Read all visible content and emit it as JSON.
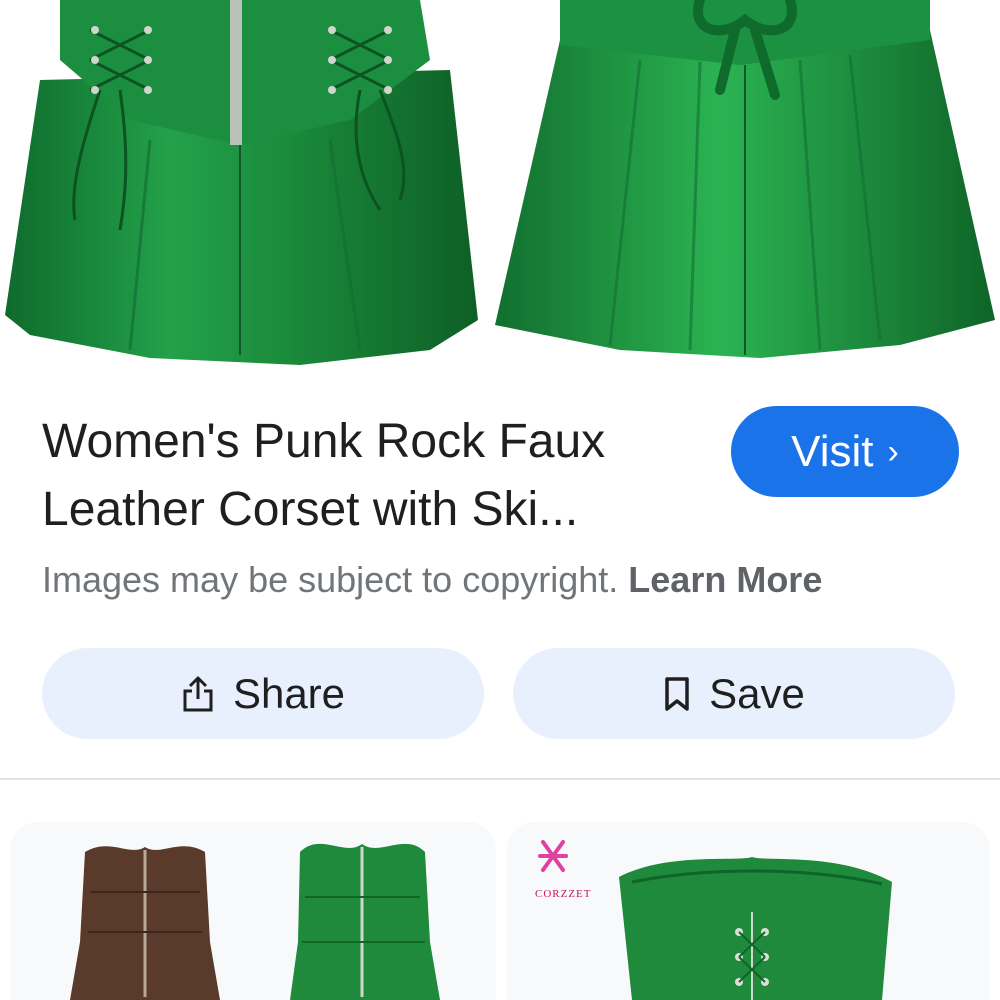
{
  "product": {
    "title": "Women's Punk Rock Faux Leather Corset with Ski...",
    "visit_label": "Visit",
    "visit_chevron": "›"
  },
  "copyright": {
    "text": "Images may be subject to copyright.",
    "link": "Learn More"
  },
  "actions": {
    "share_label": "Share",
    "save_label": "Save"
  },
  "related": {
    "brand_text": "CORZZET"
  },
  "colors": {
    "accent": "#1a73e8",
    "action_bg": "#e8f0fe",
    "garment_green": "#1f8a3c",
    "garment_brown": "#5a3a2a",
    "brand_pink": "#e040a0"
  }
}
